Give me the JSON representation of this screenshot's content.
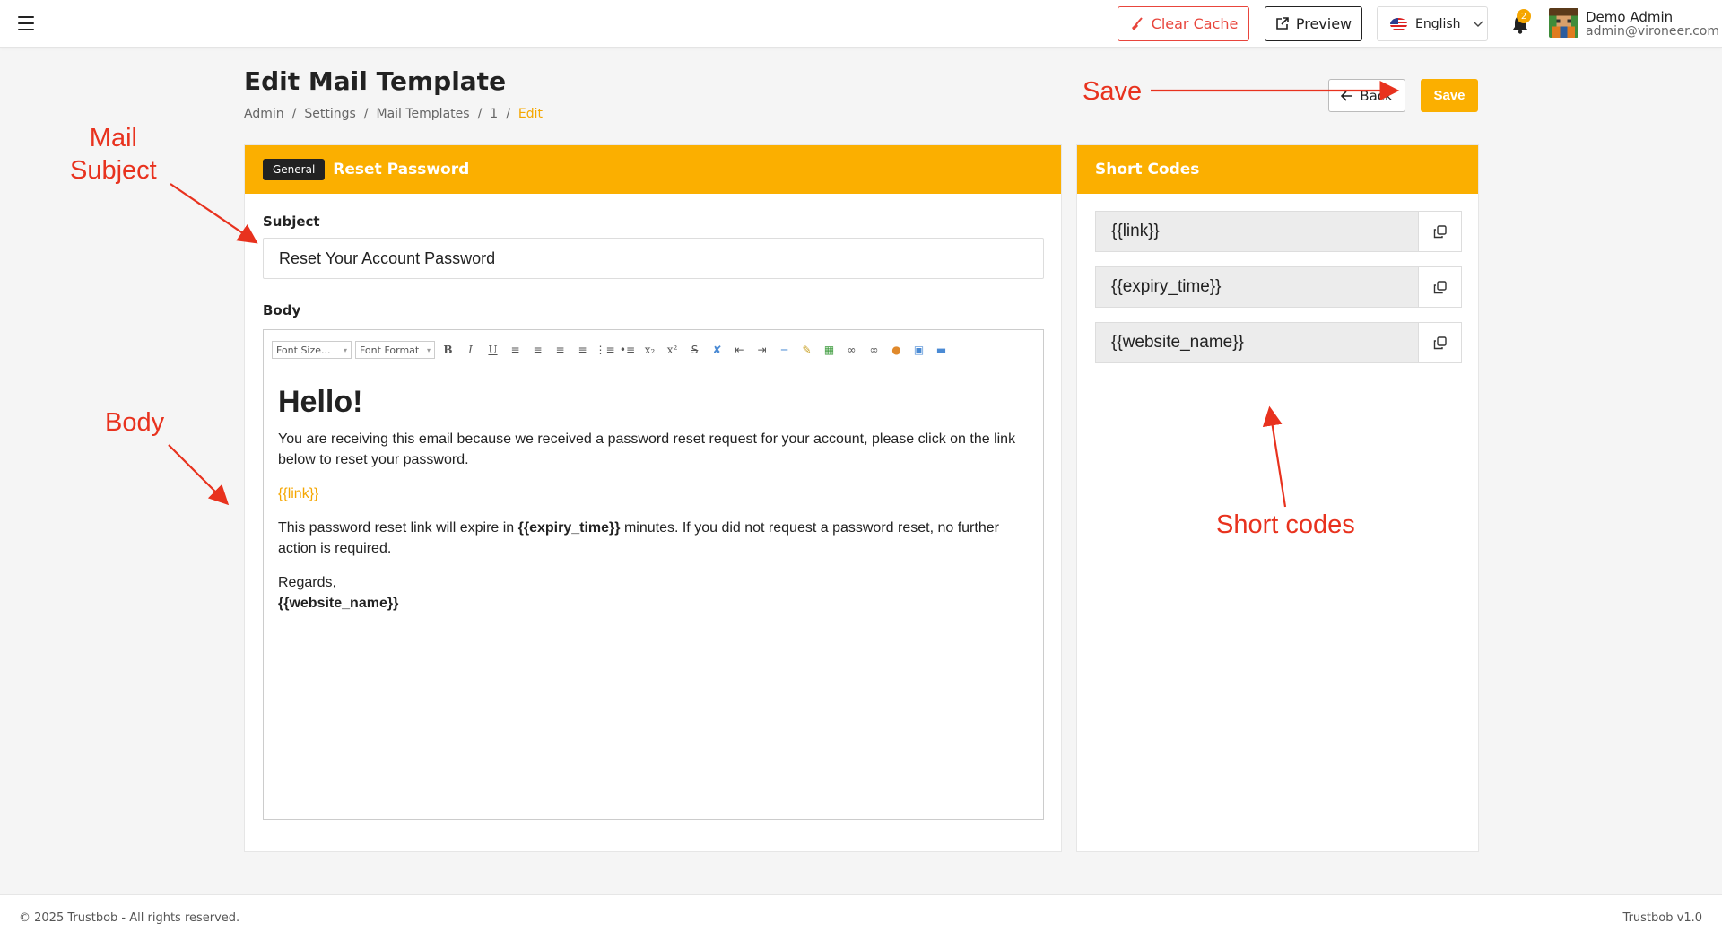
{
  "topbar": {
    "clear_cache_label": "Clear Cache",
    "preview_label": "Preview",
    "language": "English",
    "notification_count": "2",
    "user_name": "Demo Admin",
    "user_email": "admin@vironeer.com"
  },
  "page": {
    "title": "Edit Mail Template",
    "breadcrumb": [
      "Admin",
      "Settings",
      "Mail Templates",
      "1",
      "Edit"
    ],
    "back_label": "Back",
    "save_label": "Save"
  },
  "editor_card": {
    "badge": "General",
    "title": "Reset Password",
    "subject_label": "Subject",
    "subject_value": "Reset Your Account Password",
    "body_label": "Body",
    "toolbar": {
      "font_size_placeholder": "Font Size...",
      "font_format_placeholder": "Font Format"
    },
    "body": {
      "heading": "Hello!",
      "para1": "You are receiving this email because we received a password reset request for your account, please click on the link below to reset your password.",
      "link_code": "{{link}}",
      "para2_before": "This password reset link will expire in ",
      "para2_code": "{{expiry_time}}",
      "para2_after": " minutes. If you did not request a password reset, no further action is required.",
      "regards": "Regards,",
      "signature": "{{website_name}}"
    }
  },
  "shortcodes_card": {
    "title": "Short Codes",
    "codes": [
      "{{link}}",
      "{{expiry_time}}",
      "{{website_name}}"
    ]
  },
  "annotations": {
    "mail_subject": "Mail\nSubject",
    "body": "Body",
    "save": "Save",
    "short_codes": "Short codes"
  },
  "footer": {
    "copyright": "© 2025 Trustbob - All rights reserved.",
    "version": "Trustbob v1.0"
  },
  "colors": {
    "accent": "#fbaf00",
    "danger": "#e8453c",
    "annotation": "#e8321e"
  }
}
